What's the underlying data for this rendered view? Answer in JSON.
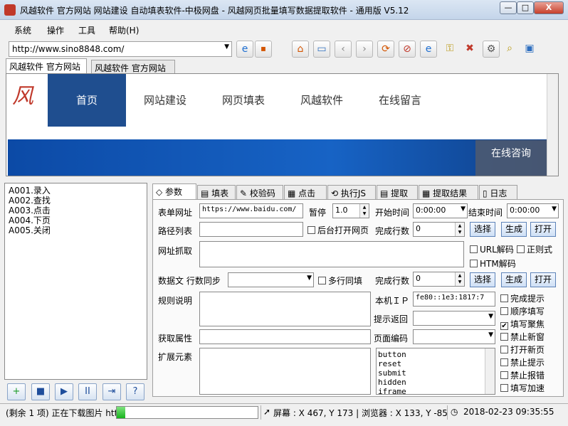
{
  "window": {
    "title": "风越软件 官方网站 网站建设 自动填表软件-中极网盘 - 风越网页批量填写数据提取软件 - 通用版 V5.12",
    "min": "—",
    "max": "□",
    "close": "X"
  },
  "menu": [
    "系统",
    "操作",
    "工具",
    "帮助(H)"
  ],
  "toolbar": {
    "url": "http://www.sino8848.com/",
    "icons": [
      "ie-go-icon",
      "stop-icon",
      "home-icon",
      "folder-icon",
      "back-icon",
      "forward-icon",
      "refresh-icon",
      "no-icon",
      "ie-icon",
      "key-icon",
      "close-red-icon",
      "gear-icon",
      "search-icon",
      "window-icon"
    ]
  },
  "browser_tabs": [
    "风越软件 官方网站",
    "风越软件 官方网站"
  ],
  "site": {
    "logo": "风",
    "nav": [
      "首页",
      "网站建设",
      "网页填表",
      "风越软件",
      "在线留言"
    ],
    "consult": "在线咨询"
  },
  "task_list": [
    "A001.录入",
    "A002.查找",
    "A003.点击",
    "A004.下页",
    "A005.关闭"
  ],
  "bottom_buttons": [
    "+",
    "■",
    "▶",
    "II",
    "⇥",
    "?"
  ],
  "tabs": [
    "参数",
    "填表",
    "校验码",
    "点击",
    "执行JS",
    "提取",
    "提取结果",
    "日志"
  ],
  "params": {
    "form_url_label": "表单网址",
    "form_url": "https://www.baidu.com/",
    "pause_label": "暂停",
    "pause": "1.0",
    "start_time_label": "开始时间",
    "start_time": "0:00:00",
    "end_time_label": "结束时间",
    "end_time": "0:00:00",
    "path_list_label": "路径列表",
    "bg_open_label": "后台打开网页",
    "done_rows_label": "完成行数",
    "done_rows": "0",
    "select_label": "选择",
    "generate_label": "生成",
    "open_label": "打开",
    "url_fetch_label": "网址抓取",
    "url_decode_label": "URL解码",
    "regex_label": "正则式",
    "htm_decode_label": "HTM解码",
    "data_file_label": "数据文 行数同步",
    "multi_row_label": "多行同填",
    "done_rows2_label": "完成行数",
    "done_rows2": "0",
    "select2_label": "选择",
    "generate2_label": "生成",
    "open2_label": "打开",
    "rule_desc_label": "规则说明",
    "local_ip_label": "本机ＩＰ",
    "local_ip": "fe80::1e3:1817:7",
    "prompt_return_label": "提示返回",
    "get_attr_label": "获取属性",
    "page_encoding_label": "页面编码",
    "ext_elem_label": "扩展元素",
    "elements": [
      "button",
      "reset",
      "submit",
      "hidden",
      "iframe"
    ],
    "options": [
      {
        "label": "完成提示",
        "checked": false
      },
      {
        "label": "顺序填写",
        "checked": false
      },
      {
        "label": "填写聚焦",
        "checked": true
      },
      {
        "label": "禁止新窗",
        "checked": false
      },
      {
        "label": "打开新页",
        "checked": false
      },
      {
        "label": "禁止提示",
        "checked": false
      },
      {
        "label": "禁止报错",
        "checked": false
      },
      {
        "label": "填写加速",
        "checked": false
      }
    ]
  },
  "status": {
    "remaining": "(剩余 1 项) 正在下载图片 htt",
    "progress": 0.06,
    "screen": "屏幕 : X 467, Y 173 | 浏览器 : X 133, Y -85",
    "datetime": "2018-02-23 09:35:55"
  }
}
